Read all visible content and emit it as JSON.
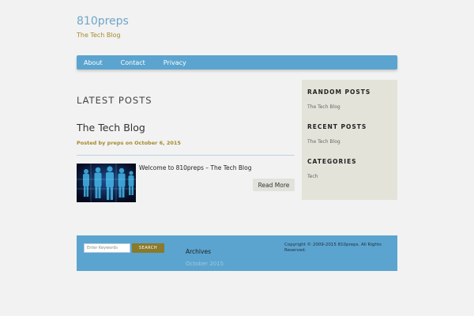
{
  "header": {
    "site_title": "810preps",
    "tagline": "The Tech Blog"
  },
  "nav": {
    "items": [
      "About",
      "Contact",
      "Privacy"
    ]
  },
  "main": {
    "section_heading": "LATEST POSTS",
    "post": {
      "title": "The Tech Blog",
      "meta": "Posted by preps on October 6, 2015",
      "excerpt_title": "Welcome to 810preps – The Tech Blog",
      "read_more": "Read More"
    }
  },
  "sidebar": {
    "widgets": [
      {
        "title": "RANDOM POSTS",
        "link": "The Tech Blog"
      },
      {
        "title": "RECENT POSTS",
        "link": "The Tech Blog"
      },
      {
        "title": "CATEGORIES",
        "link": "Tech"
      }
    ]
  },
  "footer": {
    "search_placeholder": "Enter Keywords",
    "search_button": "SEARCH",
    "archives_title": "Archives",
    "archives_link": "October 2015",
    "copyright": "Copyright © 2009-2015 810preps. All Rights Reserved."
  },
  "colors": {
    "accent_blue": "#5ba4cf",
    "gold": "#a68a2e",
    "sidebar_bg": "#e4e3da",
    "page_bg": "#f2f2f2"
  }
}
